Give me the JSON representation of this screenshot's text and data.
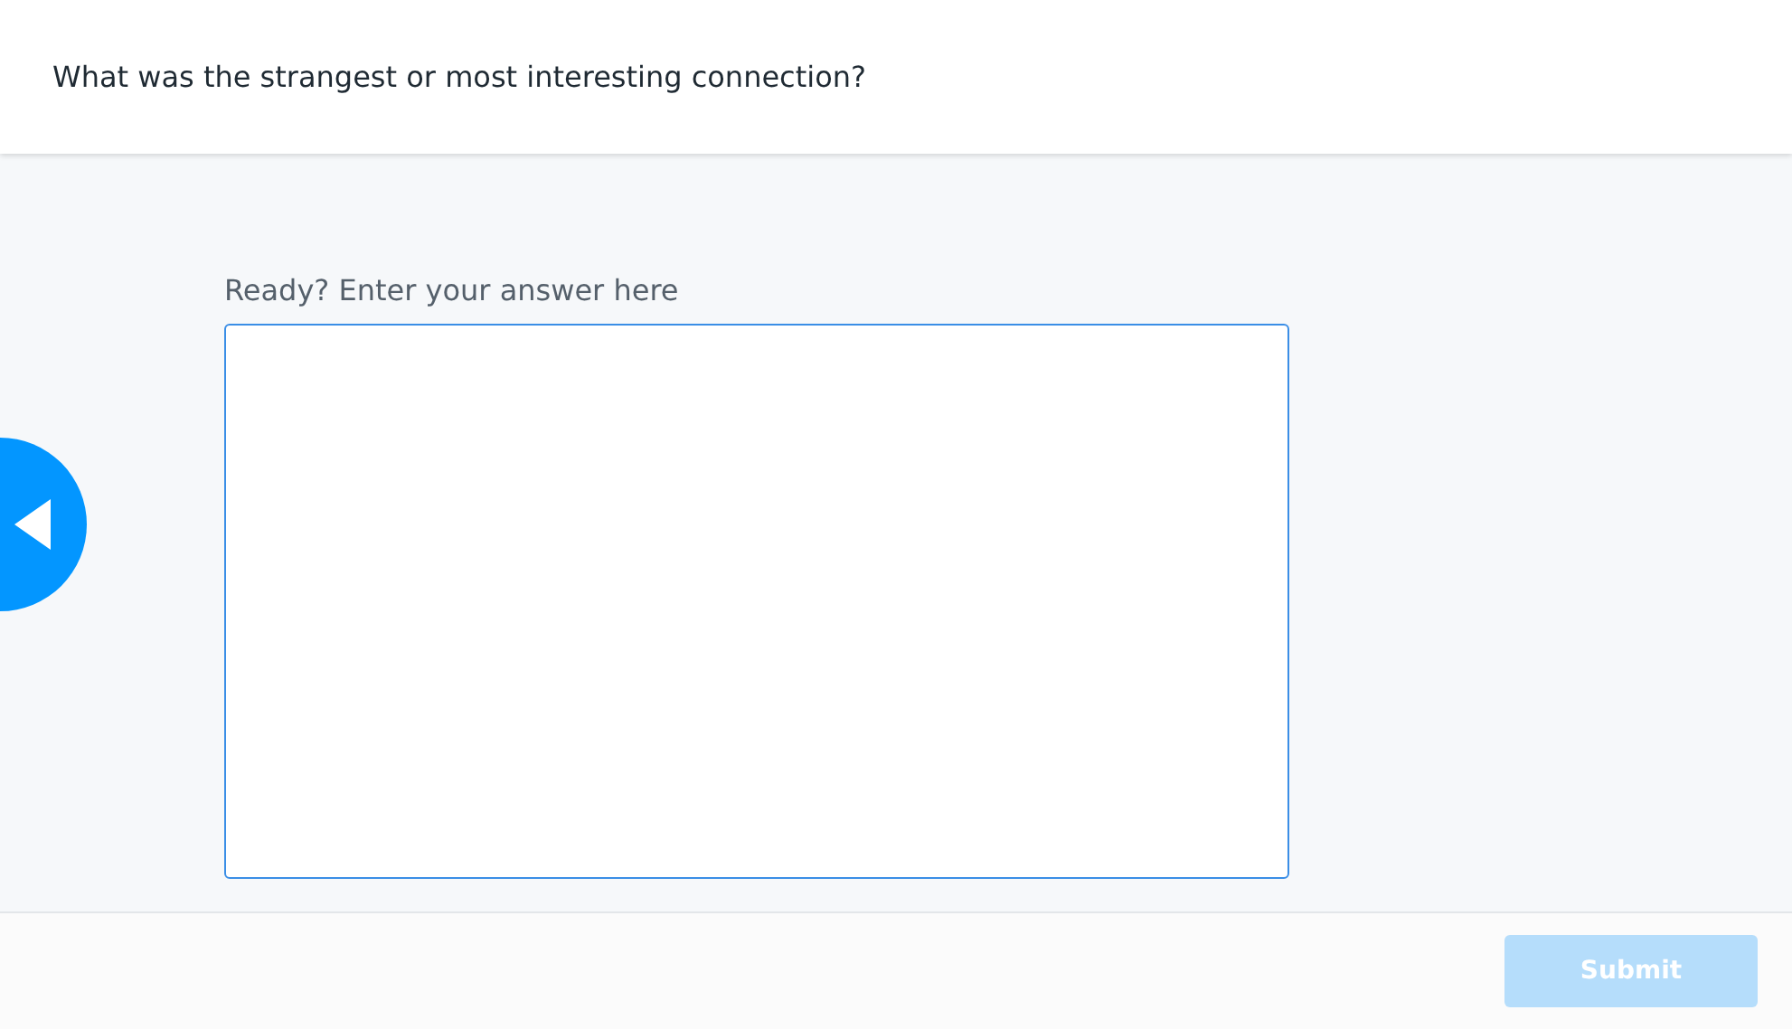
{
  "header": {
    "question": "What was the strangest or most interesting connection?"
  },
  "answer": {
    "label": "Ready? Enter your answer here"
  },
  "footer": {
    "submit": {
      "label": "Submit",
      "disabled": true
    }
  }
}
